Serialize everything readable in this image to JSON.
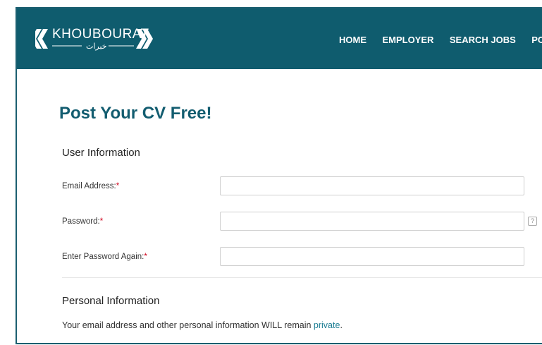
{
  "brand": {
    "name": "KHOUBOURAT",
    "arabic": "خبرات",
    "color": "#0f5c6e"
  },
  "nav": {
    "items": [
      "HOME",
      "EMPLOYER",
      "SEARCH JOBS",
      "POST Y"
    ]
  },
  "page": {
    "title": "Post Your CV Free!"
  },
  "user_info": {
    "heading": "User Information",
    "email_label": "Email Address:",
    "password_label": "Password:",
    "password_again_label": "Enter Password Again:",
    "required_mark": "*",
    "help_mark": "?"
  },
  "personal_info": {
    "heading": "Personal Information",
    "note_text": "Your email address and other personal information WILL remain ",
    "note_link": "private",
    "note_end": "."
  }
}
